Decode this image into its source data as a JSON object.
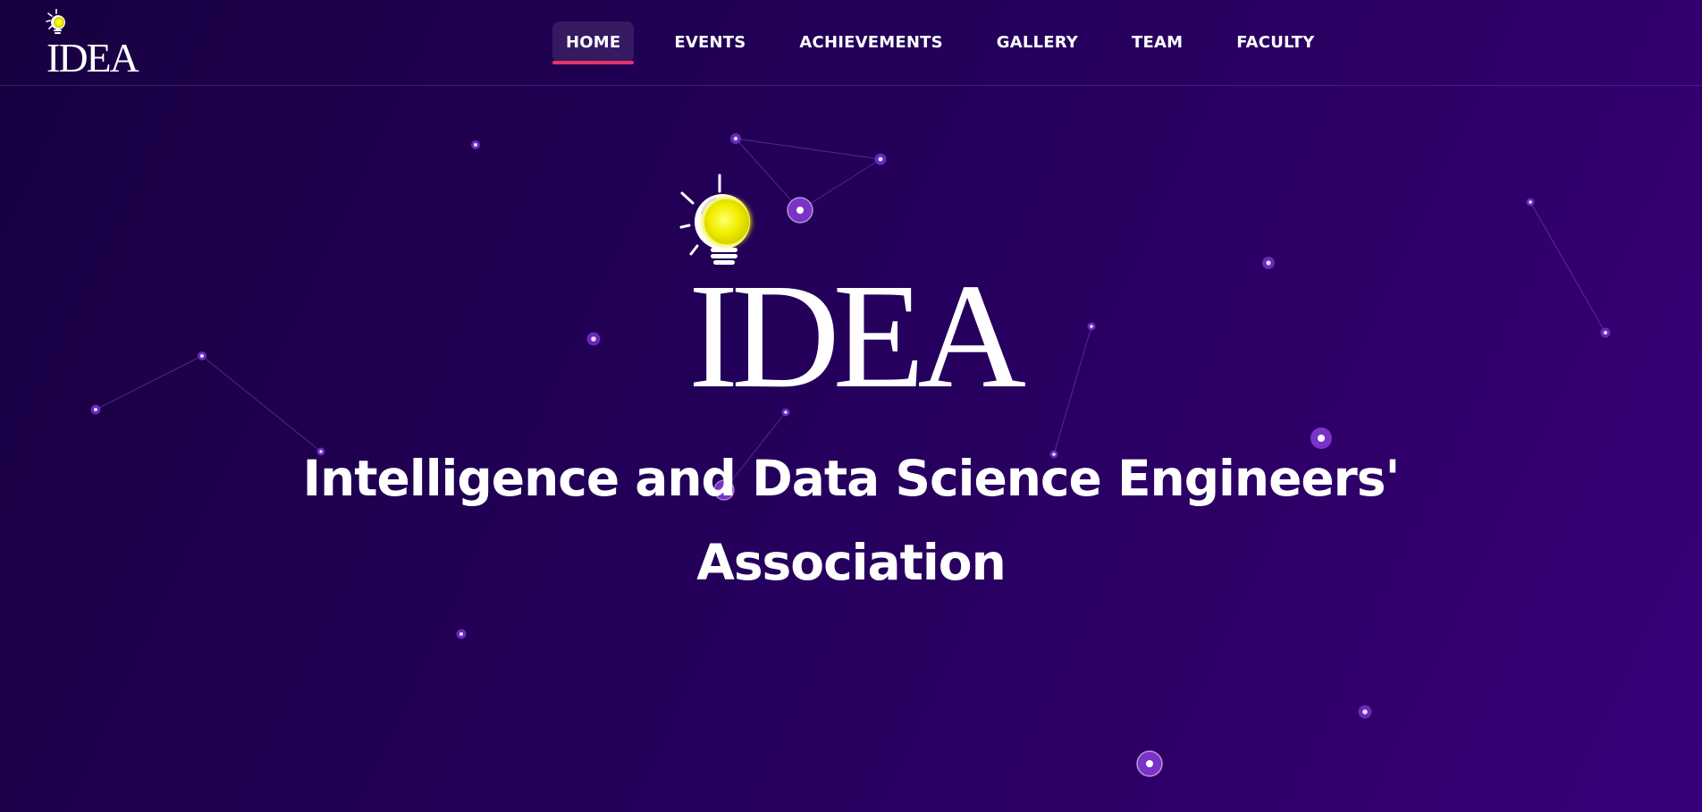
{
  "brand": {
    "logo_text": "IDEA",
    "accent_color": "#e8336b",
    "bulb_color": "#f2f000"
  },
  "nav": {
    "items": [
      {
        "label": "HOME",
        "active": true
      },
      {
        "label": "EVENTS",
        "active": false
      },
      {
        "label": "ACHIEVEMENTS",
        "active": false
      },
      {
        "label": "GALLERY",
        "active": false
      },
      {
        "label": "TEAM",
        "active": false
      },
      {
        "label": "FACULTY",
        "active": false
      }
    ]
  },
  "hero": {
    "logo_text": "IDEA",
    "title_line1": "Intelligence and Data Science Engineers'",
    "title_line2": "Association"
  }
}
